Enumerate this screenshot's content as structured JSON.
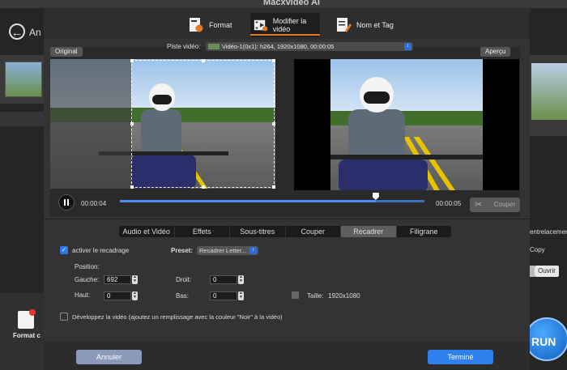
{
  "app": {
    "title": "Macxvideo AI"
  },
  "background": {
    "back_label": "An",
    "right_entrelacement": "entrelacement",
    "right_copy": "Copy",
    "right_ouvrir": "Ouvrir",
    "format_label": "Format c",
    "run_label": "RUN"
  },
  "tabs": [
    {
      "label": "Format"
    },
    {
      "label": "Modifier la vidéo"
    },
    {
      "label": "Nom et Tag"
    }
  ],
  "preview": {
    "original_label": "Original",
    "apercu_label": "Aperçu",
    "piste_label": "Piste vidéo:",
    "piste_value": "Vidéo-1(0x1): h264, 1920x1080, 00:00:05"
  },
  "player": {
    "current_time": "00:00:04",
    "total_time": "00:00:05",
    "progress": 0.84,
    "couper_label": "Couper"
  },
  "subtabs": [
    {
      "label": "Audio et Vidéo"
    },
    {
      "label": "Effets"
    },
    {
      "label": "Sous-titres"
    },
    {
      "label": "Couper"
    },
    {
      "label": "Recadrer"
    },
    {
      "label": "Filigrane"
    }
  ],
  "crop": {
    "enable_label": "activer le recadrage",
    "enabled": true,
    "preset_label": "Preset:",
    "preset_value": "Recadrer Letter...",
    "position_label": "Position:",
    "gauche_label": "Gauche:",
    "gauche_value": "692",
    "droit_label": "Droit:",
    "droit_value": "0",
    "haut_label": "Haut:",
    "haut_value": "0",
    "bas_label": "Bas:",
    "bas_value": "0",
    "taille_label": "Taille:",
    "taille_value": "1920x1080",
    "expand_label": "Développez la vidéo (ajoutez un remplissage avec la couleur \"Noir\" à la vidéo)",
    "expand_enabled": false
  },
  "footer": {
    "cancel_label": "Annuler",
    "done_label": "Terminé"
  },
  "colors": {
    "accent": "#2f80ed",
    "tab_underline": "#e87722"
  }
}
